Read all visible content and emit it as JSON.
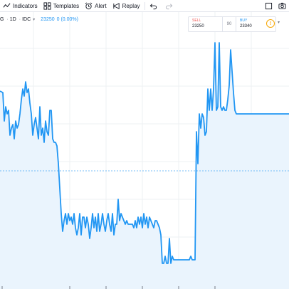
{
  "toolbar": {
    "indicators_label": "Indicators",
    "templates_label": "Templates",
    "alert_label": "Alert",
    "replay_label": "Replay"
  },
  "legend": {
    "symbol": "G",
    "interval": "1D",
    "exchange": "IDC",
    "price": "23250",
    "change": "0 (0.00%)"
  },
  "trade": {
    "sell_label": "SELL",
    "sell_price": "23250",
    "spread": "90",
    "buy_label": "BUY",
    "buy_price": "23340"
  },
  "colors": {
    "line": "#2196f3",
    "area": "#eaf4fd",
    "grid": "#eef0f3",
    "sell": "#ef5350",
    "buy": "#2196f3",
    "warning": "#f7a600"
  },
  "chart_data": {
    "type": "area",
    "x": [
      0,
      4,
      6,
      8,
      10,
      12,
      14,
      16,
      18,
      20,
      22,
      24,
      26,
      28,
      30,
      32,
      34,
      36,
      38,
      40,
      42,
      44,
      46,
      48,
      50,
      52,
      54,
      56,
      58,
      60,
      62,
      64,
      66,
      68,
      70,
      72,
      74,
      76,
      78,
      80,
      82,
      84,
      86,
      88,
      90,
      92,
      94,
      96,
      98,
      100,
      102,
      104,
      106,
      108,
      110,
      112,
      114,
      116,
      118,
      120,
      122,
      124,
      126,
      128,
      130,
      132,
      134,
      136,
      138,
      140,
      142,
      144,
      146,
      148,
      150,
      152,
      154,
      156,
      158,
      160,
      162,
      164,
      166,
      168,
      170,
      172,
      174,
      176,
      178,
      180,
      182,
      184,
      186,
      188,
      190,
      192,
      194,
      196,
      198,
      200,
      202,
      204,
      206,
      208,
      210,
      212,
      214,
      216,
      218,
      220,
      222,
      224,
      226,
      228,
      230,
      232,
      234,
      236,
      238,
      240,
      242,
      244,
      246,
      248,
      250,
      252,
      254,
      256,
      258,
      260,
      262,
      264,
      266,
      268,
      270,
      272,
      274,
      276,
      278,
      280,
      282,
      284,
      286,
      288,
      290,
      292,
      294,
      296,
      298,
      300,
      302,
      304,
      306,
      308,
      310,
      312,
      314,
      316,
      318,
      320,
      322,
      324,
      326,
      328,
      330,
      332,
      334,
      336,
      338,
      340,
      342,
      344,
      346,
      348,
      350,
      352,
      354,
      356,
      358,
      360,
      362,
      364,
      366,
      368,
      370,
      372,
      374,
      376,
      378,
      380,
      382,
      384,
      386,
      388,
      390,
      392,
      394,
      396,
      398,
      400,
      402,
      406
    ],
    "y": [
      128,
      130,
      170,
      150,
      160,
      155,
      190,
      180,
      175,
      195,
      170,
      180,
      175,
      160,
      140,
      125,
      135,
      115,
      130,
      125,
      145,
      160,
      190,
      175,
      165,
      180,
      195,
      150,
      190,
      180,
      200,
      170,
      185,
      190,
      155,
      155,
      195,
      200,
      200,
      205,
      230,
      265,
      300,
      325,
      310,
      300,
      315,
      300,
      310,
      305,
      315,
      300,
      320,
      330,
      320,
      300,
      330,
      305,
      305,
      320,
      305,
      315,
      335,
      320,
      300,
      320,
      305,
      325,
      300,
      325,
      315,
      300,
      315,
      325,
      310,
      300,
      315,
      325,
      300,
      330,
      315,
      315,
      280,
      310,
      300,
      305,
      310,
      315,
      310,
      315,
      315,
      315,
      315,
      320,
      310,
      320,
      305,
      315,
      305,
      320,
      300,
      315,
      305,
      320,
      305,
      310,
      315,
      320,
      310,
      310,
      315,
      320,
      330,
      370,
      370,
      360,
      370,
      370,
      335,
      370,
      360,
      365,
      365,
      365,
      365,
      365,
      365,
      365,
      365,
      365,
      365,
      365,
      365,
      360,
      365,
      365,
      365,
      185,
      230,
      160,
      180,
      160,
      165,
      190,
      185,
      125,
      155,
      125,
      155,
      125,
      60,
      155,
      150,
      60,
      150,
      155,
      150,
      155,
      155,
      140,
      120,
      70,
      100,
      130,
      155,
      160,
      160,
      160,
      160,
      160,
      160,
      160,
      160,
      160,
      160,
      160,
      160,
      160,
      160,
      160,
      160,
      160,
      160,
      160,
      160,
      160,
      160,
      160,
      160,
      160,
      160,
      160,
      160,
      160,
      160,
      160,
      160,
      160,
      160,
      160,
      160,
      160,
      160,
      160,
      160,
      160,
      160
    ],
    "ylim": [
      0,
      406
    ]
  }
}
